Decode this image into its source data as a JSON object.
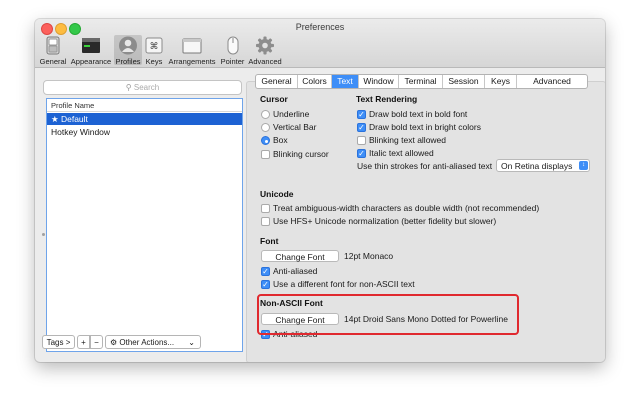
{
  "window": {
    "title": "Preferences"
  },
  "toolbar": {
    "items": [
      {
        "label": "General",
        "icon": "general-switch-icon"
      },
      {
        "label": "Appearance",
        "icon": "appearance-icon"
      },
      {
        "label": "Profiles",
        "icon": "person-icon"
      },
      {
        "label": "Keys",
        "icon": "keys-icon"
      },
      {
        "label": "Arrangements",
        "icon": "arrangements-window-icon"
      },
      {
        "label": "Pointer",
        "icon": "mouse-icon"
      },
      {
        "label": "Advanced",
        "icon": "gear-icon"
      }
    ],
    "selected": "Profiles"
  },
  "sidebar": {
    "search_placeholder": "Search",
    "column_header": "Profile Name",
    "profiles": [
      "★ Default",
      "Hotkey Window"
    ],
    "selected_profile": "★ Default",
    "tags_label": "Tags >",
    "add_label": "+",
    "remove_label": "−",
    "other_actions_label": "Other Actions..."
  },
  "tabs": [
    "General",
    "Colors",
    "Text",
    "Window",
    "Terminal",
    "Session",
    "Keys",
    "Advanced"
  ],
  "selected_tab": "Text",
  "cursor": {
    "heading": "Cursor",
    "options": [
      "Underline",
      "Vertical Bar",
      "Box"
    ],
    "selected": "Box",
    "blinking_label": "Blinking cursor",
    "blinking_checked": false
  },
  "text_rendering": {
    "heading": "Text Rendering",
    "draw_bold_font": {
      "label": "Draw bold text in bold font",
      "checked": true
    },
    "draw_bold_bright": {
      "label": "Draw bold text in bright colors",
      "checked": true
    },
    "blinking_text": {
      "label": "Blinking text allowed",
      "checked": false
    },
    "italic_text": {
      "label": "Italic text allowed",
      "checked": true
    },
    "thin_strokes_label": "Use thin strokes for anti-aliased text",
    "thin_strokes_value": "On Retina displays"
  },
  "unicode": {
    "heading": "Unicode",
    "ambiguous_width": {
      "label": "Treat ambiguous-width characters as double width (not recommended)",
      "checked": false
    },
    "hfs_normalization": {
      "label": "Use HFS+ Unicode normalization (better fidelity but slower)",
      "checked": false
    }
  },
  "font": {
    "heading": "Font",
    "change_button": "Change Font",
    "current": "12pt Monaco",
    "anti_aliased": {
      "label": "Anti-aliased",
      "checked": true
    },
    "different_non_ascii": {
      "label": "Use a different font for non-ASCII text",
      "checked": true
    }
  },
  "non_ascii_font": {
    "heading": "Non-ASCII Font",
    "change_button": "Change Font",
    "current": "14pt Droid Sans Mono Dotted for Powerline",
    "anti_aliased": {
      "label": "Anti-aliased",
      "checked": true
    }
  },
  "colors": {
    "accent": "#3e8ef7",
    "selection": "#1d62d3",
    "highlight_box": "#e0292f"
  }
}
